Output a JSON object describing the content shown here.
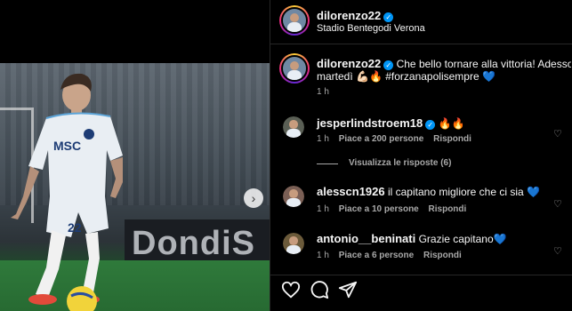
{
  "post": {
    "author": "dilorenzo22",
    "location": "Stadio Bentegodi Verona",
    "caption": "Che bello tornare alla vittoria! Adesso testa a",
    "caption_line2": "martedì 💪🏻🔥 #forzanapolisempre 💙",
    "caption_time": "1 h"
  },
  "photo": {
    "board_text": "DondiS",
    "jersey_text": "MSC",
    "shorts_number": "22"
  },
  "comments": [
    {
      "username": "jesperlindstroem18",
      "verified": true,
      "text": "🔥🔥",
      "time": "1 h",
      "likes": "Piace a 200 persone",
      "reply": "Rispondi",
      "view_replies": "Visualizza le risposte (6)"
    },
    {
      "username": "alesscn1926",
      "verified": false,
      "text": "il capitano migliore che ci sia 💙",
      "time": "1 h",
      "likes": "Piace a 10 persone",
      "reply": "Rispondi"
    },
    {
      "username": "antonio__beninati",
      "verified": false,
      "text": "Grazie capitano💙",
      "time": "1 h",
      "likes": "Piace a 6 persone",
      "reply": "Rispondi"
    }
  ],
  "icons": {
    "like": "heart-outline-icon",
    "comment": "comment-bubble-icon",
    "share": "paper-plane-icon",
    "next": "chevron-right-icon"
  },
  "colors": {
    "verified": "#0095f6",
    "secondary_text": "#a8a8a8",
    "background": "#000000"
  }
}
